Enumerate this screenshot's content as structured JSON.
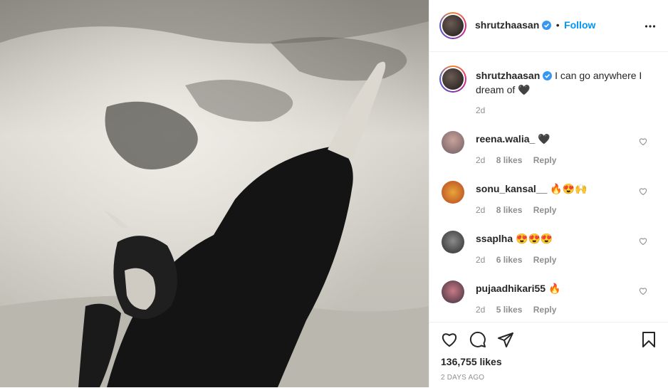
{
  "post": {
    "author": "shrutzhaasan",
    "follow_label": "Follow",
    "separator": "•",
    "caption_text": "I can go anywhere I dream of 🖤",
    "caption_time": "2d"
  },
  "comments": [
    {
      "user": "reena.walia_",
      "text": "🖤",
      "time": "2d",
      "likes": "8 likes",
      "reply": "Reply"
    },
    {
      "user": "sonu_kansal__",
      "text": "🔥😍🙌",
      "time": "2d",
      "likes": "8 likes",
      "reply": "Reply"
    },
    {
      "user": "ssaplha",
      "text": "😍😍😍",
      "time": "2d",
      "likes": "6 likes",
      "reply": "Reply"
    },
    {
      "user": "pujaadhikari55",
      "text": "🔥",
      "time": "2d",
      "likes": "5 likes",
      "reply": "Reply"
    }
  ],
  "footer": {
    "likes": "136,755 likes",
    "posted": "2 DAYS AGO"
  },
  "colors": {
    "accent": "#0095f6",
    "text": "#262626",
    "muted": "#8e8e8e",
    "border": "#efefef"
  },
  "icons": [
    "verified-badge-icon",
    "more-options-icon",
    "heart-icon",
    "comment-icon",
    "share-icon",
    "bookmark-icon"
  ]
}
